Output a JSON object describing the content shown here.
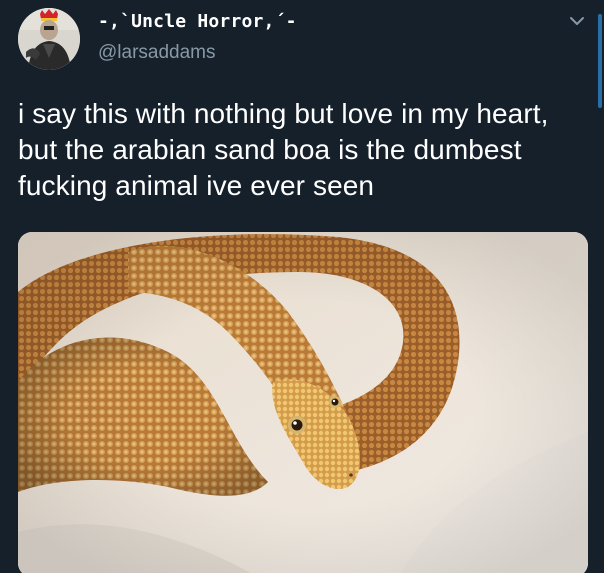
{
  "tweet": {
    "display_name": "-,`Uncle Horror,´-",
    "handle": "@larsaddams",
    "text": "i say this with nothing but love in my heart, but the arabian sand boa is the dumbest fucking animal ive ever seen"
  },
  "icons": {
    "caret": "chevron-down-icon",
    "avatar": "profile-avatar"
  },
  "colors": {
    "background": "#15202b",
    "secondary_text": "#8899a6",
    "primary_text": "#ffffff"
  }
}
